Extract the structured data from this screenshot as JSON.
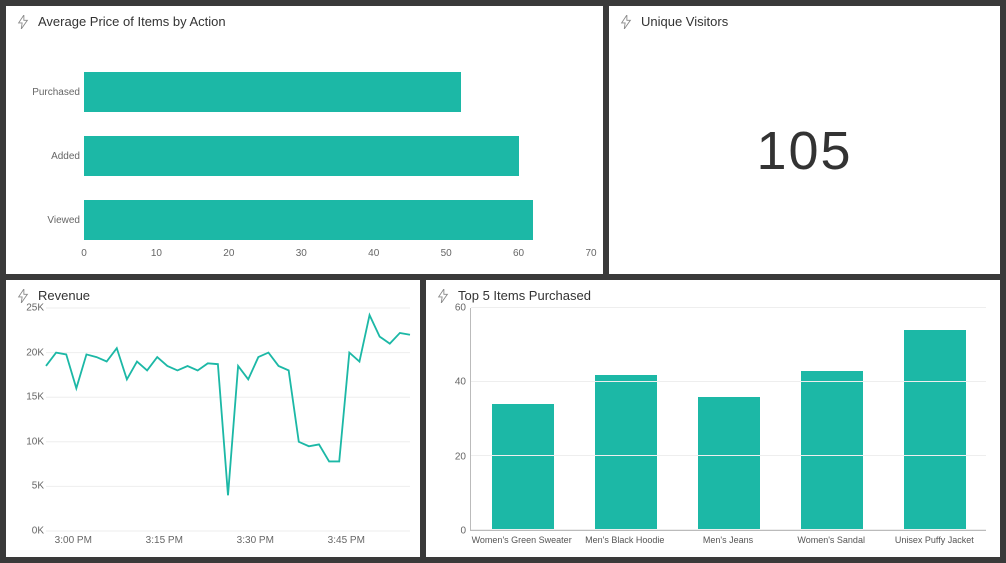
{
  "colors": {
    "accent": "#1cb8a6"
  },
  "tiles": {
    "avgPrice": {
      "title": "Average Price of Items by Action"
    },
    "visitors": {
      "title": "Unique Visitors",
      "value": "105"
    },
    "revenue": {
      "title": "Revenue"
    },
    "top5": {
      "title": "Top 5 Items Purchased"
    }
  },
  "chart_data": [
    {
      "id": "avg_price_by_action",
      "type": "bar",
      "orientation": "horizontal",
      "title": "Average Price of Items by Action",
      "categories": [
        "Purchased",
        "Added",
        "Viewed"
      ],
      "values": [
        52,
        60,
        62
      ],
      "xlabel": "",
      "ylabel": "",
      "xlim": [
        0,
        70
      ],
      "xticks": [
        0,
        10,
        20,
        30,
        40,
        50,
        60,
        70
      ]
    },
    {
      "id": "unique_visitors",
      "type": "kpi",
      "title": "Unique Visitors",
      "value": 105
    },
    {
      "id": "revenue",
      "type": "line",
      "title": "Revenue",
      "xlabel": "",
      "ylabel": "",
      "ylim": [
        0,
        25000
      ],
      "yticks": [
        0,
        5000,
        10000,
        15000,
        20000,
        25000
      ],
      "ytick_labels": [
        "0K",
        "5K",
        "10K",
        "15K",
        "20K",
        "25K"
      ],
      "xticks": [
        "3:00 PM",
        "3:15 PM",
        "3:30 PM",
        "3:45 PM"
      ],
      "x": [
        0,
        1,
        2,
        3,
        4,
        5,
        6,
        7,
        8,
        9,
        10,
        11,
        12,
        13,
        14,
        15,
        16,
        17,
        18,
        19,
        20,
        21,
        22,
        23,
        24,
        25,
        26,
        27,
        28,
        29,
        30,
        31,
        32,
        33,
        34,
        35,
        36
      ],
      "values": [
        18500,
        20000,
        19800,
        16000,
        19800,
        19500,
        19000,
        20500,
        17000,
        19000,
        18000,
        19500,
        18500,
        18000,
        18500,
        18000,
        18800,
        18700,
        4000,
        18500,
        17000,
        19500,
        20000,
        18500,
        18000,
        10000,
        9500,
        9700,
        7800,
        7800,
        20000,
        19000,
        24200,
        21800,
        21000,
        22200,
        22000
      ]
    },
    {
      "id": "top5_items_purchased",
      "type": "bar",
      "orientation": "vertical",
      "title": "Top 5 Items Purchased",
      "categories": [
        "Women's Green Sweater",
        "Men's Black Hoodie",
        "Men's Jeans",
        "Women's Sandal",
        "Unisex Puffy Jacket"
      ],
      "values": [
        34,
        42,
        36,
        43,
        54
      ],
      "xlabel": "",
      "ylabel": "",
      "ylim": [
        0,
        60
      ],
      "yticks": [
        0,
        20,
        40,
        60
      ]
    }
  ]
}
